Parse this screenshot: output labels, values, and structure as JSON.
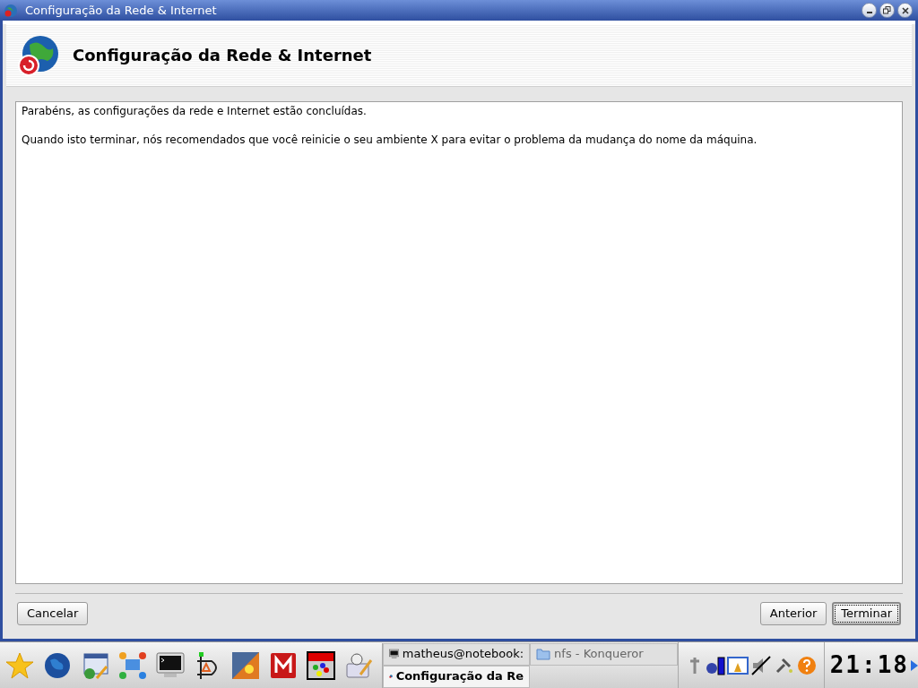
{
  "window": {
    "title": "Configuração da Rede & Internet"
  },
  "header": {
    "title": "Configuração da Rede & Internet"
  },
  "message": {
    "paragraphs": [
      "Parabéns, as configurações da rede e Internet estão concluídas.",
      "Quando isto terminar, nós recomendados que você reinicie o seu ambiente X para evitar o problema da mudança do nome da máquina."
    ]
  },
  "buttons": {
    "left": [
      {
        "label": "Cancelar",
        "default": false
      }
    ],
    "right": [
      {
        "label": "Anterior",
        "default": false
      },
      {
        "label": "Terminar",
        "default": true
      }
    ]
  },
  "taskbar": {
    "tasks": [
      {
        "label": "matheus@notebook:",
        "kind": "terminal",
        "selected": false
      },
      {
        "label": "nfs - Konqueror",
        "kind": "folder",
        "selected": false
      },
      {
        "label": "Configuração da Re",
        "kind": "network",
        "selected": true
      }
    ],
    "clock": "21:18"
  }
}
